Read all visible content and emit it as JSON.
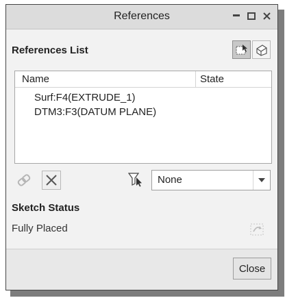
{
  "window": {
    "title": "References",
    "controls": {
      "minimize": "minimize-icon",
      "maximize": "maximize-icon",
      "close": "close-icon"
    }
  },
  "references": {
    "section_label": "References List",
    "columns": {
      "name": "Name",
      "state": "State"
    },
    "items": [
      {
        "name": "Surf:F4(EXTRUDE_1)",
        "state": ""
      },
      {
        "name": "DTM3:F3(DATUM PLANE)",
        "state": ""
      }
    ]
  },
  "toolbar": {
    "filter_value": "None",
    "icons": [
      "link-icon",
      "delete-x-icon",
      "filter-icon",
      "dropdown-caret-icon"
    ]
  },
  "sketch_status": {
    "label": "Sketch Status",
    "value": "Fully Placed"
  },
  "footer": {
    "close_label": "Close"
  },
  "colors": {
    "titlebar": "#dcdcdc",
    "dialog_bg": "#f2f2f2",
    "list_bg": "#ffffff",
    "active_toggle": "#c8c8c8"
  }
}
